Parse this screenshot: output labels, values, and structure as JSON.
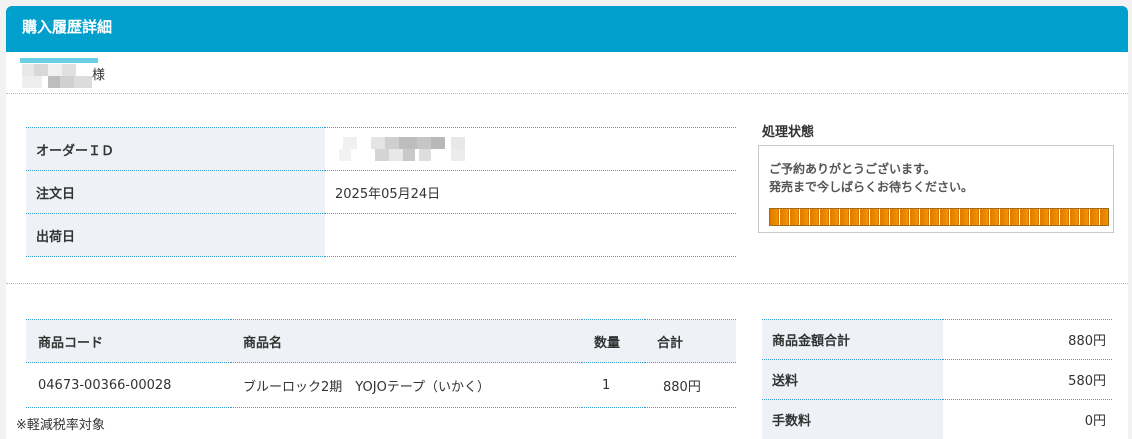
{
  "header": {
    "title": "購入履歴詳細"
  },
  "customer": {
    "suffix": "様"
  },
  "order": {
    "id_label": "オーダーＩＤ",
    "date_label": "注文日",
    "date_value": "2025年05月24日",
    "ship_label": "出荷日",
    "ship_value": ""
  },
  "status": {
    "title": "処理状態",
    "line1": "ご予約ありがとうございます。",
    "line2": "発売まで今しばらくお待ちください。",
    "progress_fraction": 1.0
  },
  "items": {
    "headers": {
      "code": "商品コード",
      "name": "商品名",
      "qty": "数量",
      "total": "合計"
    },
    "rows": [
      {
        "code": "04673-00366-00028",
        "name": "ブルーロック2期　YOJOテープ（いかく）",
        "qty": "1",
        "total": "880円"
      }
    ],
    "note": "※軽減税率対象"
  },
  "totals": {
    "rows": [
      {
        "label": "商品金額合計",
        "value": "880円"
      },
      {
        "label": "送料",
        "value": "580円"
      },
      {
        "label": "手数料",
        "value": "0円"
      }
    ]
  },
  "colors": {
    "header_bg": "#009fcc",
    "progress": "#e07b00"
  }
}
